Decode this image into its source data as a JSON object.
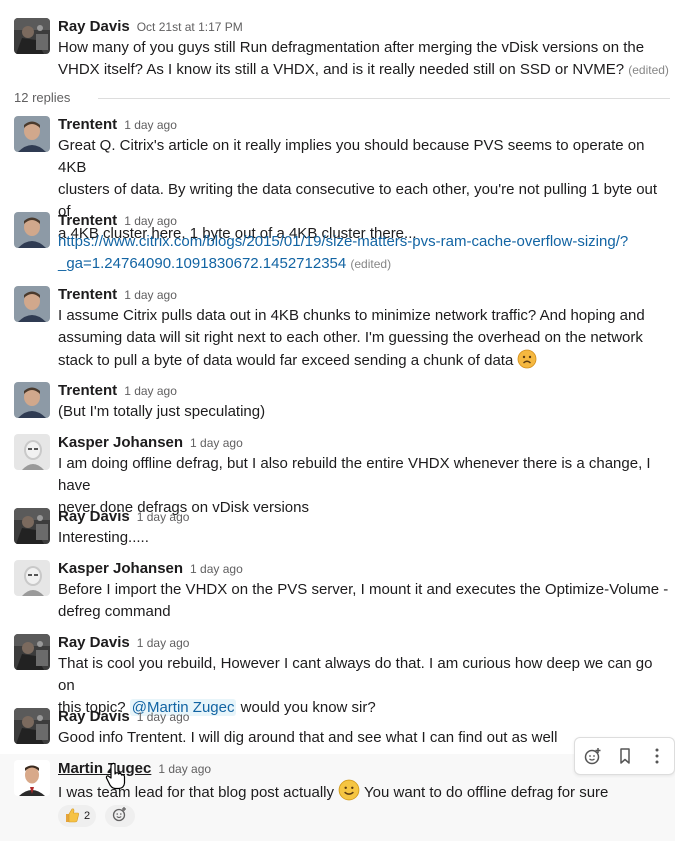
{
  "parent": {
    "author": "Ray Davis",
    "time": "Oct 21st at 1:17 PM",
    "line1": "How many of you guys still Run defragmentation after merging the vDisk versions on the",
    "line2": "VHDX itself? As I know its still a VHDX, and is it really needed still on SSD or NVME?",
    "edited": "(edited)"
  },
  "replies_label": "12 replies",
  "messages": [
    {
      "author": "Trentent",
      "time": "1 day ago",
      "lines": [
        "Great Q.  Citrix's article on it really implies you should because PVS seems to operate on 4KB",
        "clusters of data. By writing the data consecutive to each other, you're not pulling 1 byte out of",
        "a 4KB cluster here, 1 byte out of a 4KB cluster there..."
      ]
    },
    {
      "author": "Trentent",
      "time": "1 day ago",
      "link1": "https://www.citrix.com/blogs/2015/01/19/size-matters-pvs-ram-cache-overflow-sizing/?",
      "link2": "_ga=1.24764090.1091830672.1452712354",
      "edited": "(edited)"
    },
    {
      "author": "Trentent",
      "time": "1 day ago",
      "lines": [
        "I assume Citrix pulls data out in 4KB chunks to minimize network traffic?  And hoping and",
        "assuming data will sit right next to each other.  I'm guessing the overhead on the network",
        "stack to pull a byte of data would far exceed sending a chunk of data"
      ]
    },
    {
      "author": "Trentent",
      "time": "1 day ago",
      "lines": [
        "(But I'm totally just speculating)"
      ]
    },
    {
      "author": "Kasper Johansen",
      "time": "1 day ago",
      "lines": [
        "I am doing offline defrag, but I also rebuild the entire VHDX whenever there is a change, I have",
        "never done defrags on vDisk versions"
      ]
    },
    {
      "author": "Ray Davis",
      "time": "1 day ago",
      "lines": [
        "Interesting....."
      ]
    },
    {
      "author": "Kasper Johansen",
      "time": "1 day ago",
      "lines": [
        "Before I import the VHDX on the PVS server, I mount it and executes the Optimize-Volume -",
        "defreg command"
      ]
    },
    {
      "author": "Ray Davis",
      "time": "1 day ago",
      "line1": "That is cool you rebuild, However I cant always do that. I am curious how deep we can go on",
      "line2_pre": "this topic? ",
      "mention": "@Martin Zugec",
      "line2_post": " would you know sir?"
    },
    {
      "author": "Ray Davis",
      "time": "1 day ago",
      "lines": [
        "Good info Trentent. I will dig around that and see what I can find out as well"
      ]
    },
    {
      "author": "Martin Zugec",
      "time": "1 day ago",
      "pre": "I was team lead for that blog post actually ",
      "post": " You want to do offline defrag for sure"
    }
  ],
  "reaction": {
    "emoji": "thumbs-up",
    "count": "2"
  },
  "icons": {
    "add_reaction": "add-reaction-icon",
    "bookmark": "bookmark-icon",
    "more": "more-actions-icon"
  },
  "colors": {
    "link": "#1264a3",
    "mention_bg": "#e8f5fa",
    "hover_bg": "#f8f8f8"
  }
}
